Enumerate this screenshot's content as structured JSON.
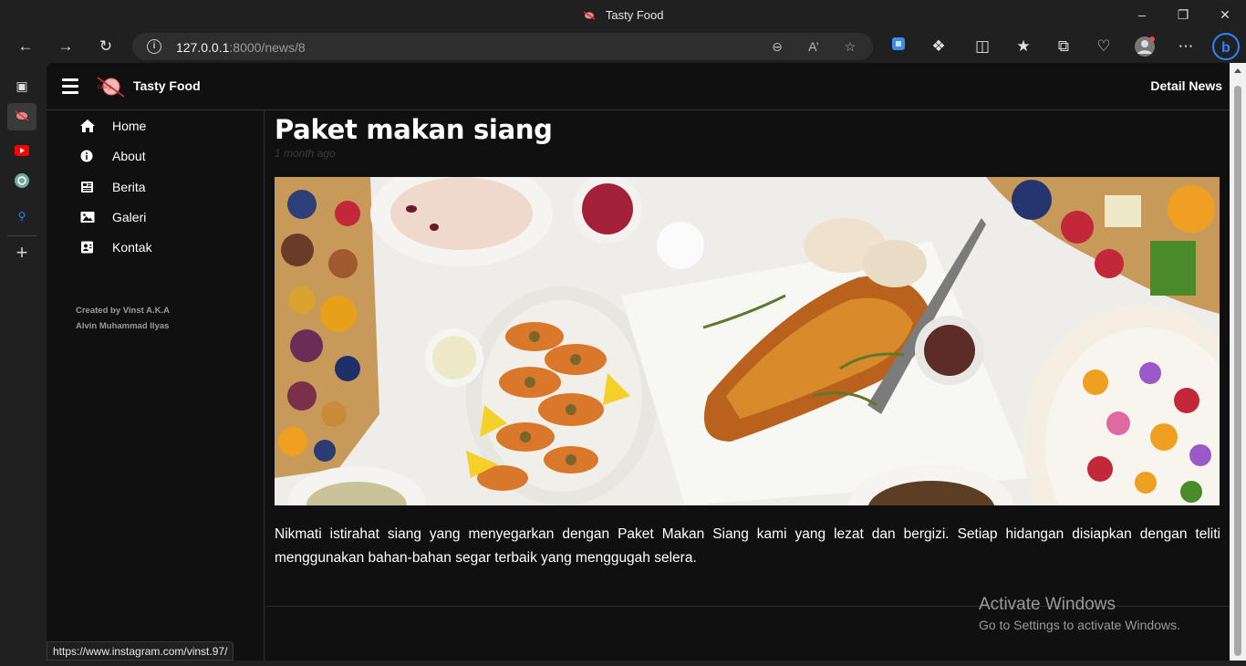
{
  "browser": {
    "window_title": "Tasty Food",
    "url_host": "127.0.0.1",
    "url_rest": ":8000/news/8",
    "status_url": "https://www.instagram.com/vinst.97/"
  },
  "app": {
    "brand": "Tasty Food",
    "detail_link": "Detail News"
  },
  "nav": {
    "items": [
      {
        "label": "Home",
        "icon": "home-icon"
      },
      {
        "label": "About",
        "icon": "info-icon"
      },
      {
        "label": "Berita",
        "icon": "newspaper-icon"
      },
      {
        "label": "Galeri",
        "icon": "image-icon"
      },
      {
        "label": "Kontak",
        "icon": "contact-icon"
      }
    ],
    "credit_line1": "Created by Vinst A.K.A",
    "credit_line2": "Alvin Muhammad Ilyas"
  },
  "article": {
    "title": "Paket makan siang",
    "time": "1 month ago",
    "body": "Nikmati istirahat siang yang menyegarkan dengan Paket Makan Siang kami yang lezat dan bergizi. Setiap hidangan disiapkan dengan teliti menggunakan bahan-bahan segar terbaik yang menggugah selera."
  },
  "os": {
    "activate_title": "Activate Windows",
    "activate_sub": "Go to Settings to activate Windows."
  },
  "colors": {
    "page_bg": "#101010",
    "browser_chrome": "#202020",
    "text": "#ffffff"
  }
}
